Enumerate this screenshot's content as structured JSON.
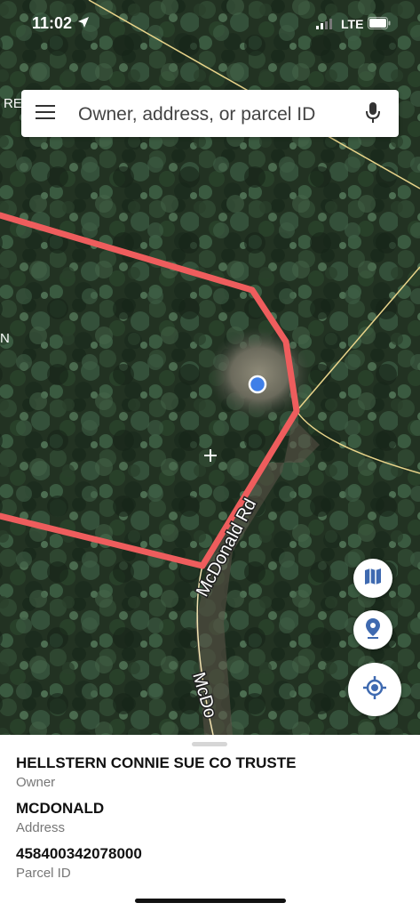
{
  "status_bar": {
    "time": "11:02",
    "network": "LTE"
  },
  "map": {
    "edge_labels": [
      "RE",
      "N"
    ],
    "road_labels": [
      "McDonald Rd",
      "McDo"
    ],
    "parcel_color": "#ee5d5d",
    "boundary_color": "#e9d48a",
    "road_color": "#f2e2b0",
    "location_dot_color": "#3f7fe8"
  },
  "search": {
    "placeholder": "Owner, address, or parcel ID"
  },
  "icons": {
    "menu": "menu-icon",
    "mic": "microphone-icon",
    "layers": "map-layers-icon",
    "pin": "location-pin-icon",
    "locate": "my-location-icon"
  },
  "parcel": {
    "owner": {
      "value": "HELLSTERN CONNIE SUE CO TRUSTE",
      "label": "Owner"
    },
    "address": {
      "value": "MCDONALD",
      "label": "Address"
    },
    "parcel_id": {
      "value": "458400342078000",
      "label": "Parcel ID"
    }
  }
}
